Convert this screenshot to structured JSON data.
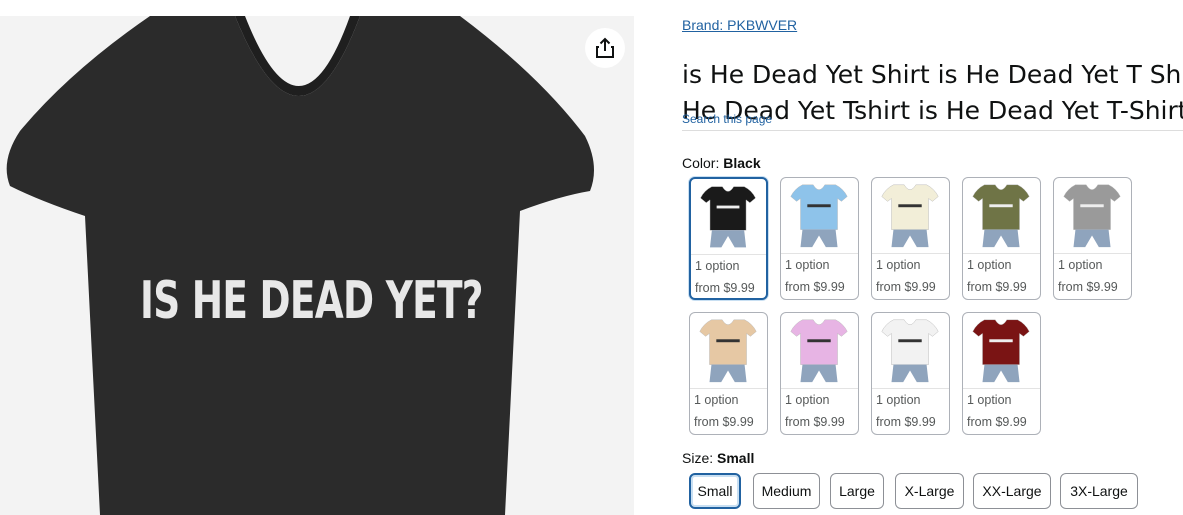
{
  "product": {
    "brand": "Brand: PKBWVER",
    "title_lines": [
      "is He Dead Yet Shirt is He Dead Yet T Shirt",
      "He Dead Yet Tshirt is He Dead Yet T-Shirt"
    ],
    "search_link": "Search this page",
    "image_text": "IS HE DEAD YET?"
  },
  "color": {
    "label": "Color:",
    "selected": "Black",
    "swatches": [
      {
        "color": "#1a1a1a",
        "option": "1 option",
        "price": "from $9.99"
      },
      {
        "color": "#8ec3ea",
        "option": "1 option",
        "price": "from $9.99"
      },
      {
        "color": "#f2eed8",
        "option": "1 option",
        "price": "from $9.99"
      },
      {
        "color": "#6f7446",
        "option": "1 option",
        "price": "from $9.99"
      },
      {
        "color": "#9a9a9a",
        "option": "1 option",
        "price": "from $9.99"
      },
      {
        "color": "#e6c8a4",
        "option": "1 option",
        "price": "from $9.99"
      },
      {
        "color": "#e7b4e4",
        "option": "1 option",
        "price": "from $9.99"
      },
      {
        "color": "#f2f2f2",
        "option": "1 option",
        "price": "from $9.99"
      },
      {
        "color": "#7a1414",
        "option": "1 option",
        "price": "from $9.99"
      }
    ]
  },
  "size": {
    "label": "Size:",
    "selected": "Small",
    "options": [
      "Small",
      "Medium",
      "Large",
      "X-Large",
      "XX-Large",
      "3X-Large"
    ]
  },
  "icons": {
    "share": "share-icon"
  }
}
